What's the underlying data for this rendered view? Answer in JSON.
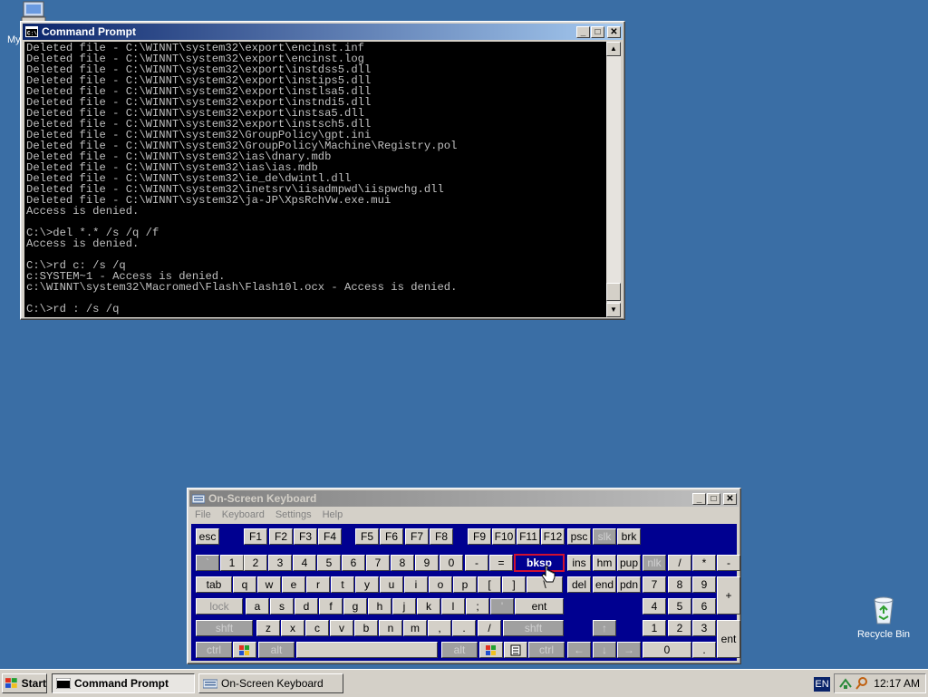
{
  "desktop": {
    "icons": [
      {
        "label": "My"
      },
      {
        "label": "Recycle Bin"
      }
    ]
  },
  "cmd_window": {
    "title": "Command Prompt",
    "lines": [
      "Deleted file - C:\\WINNT\\system32\\export\\encinst.inf",
      "Deleted file - C:\\WINNT\\system32\\export\\encinst.log",
      "Deleted file - C:\\WINNT\\system32\\export\\instdss5.dll",
      "Deleted file - C:\\WINNT\\system32\\export\\instips5.dll",
      "Deleted file - C:\\WINNT\\system32\\export\\instlsa5.dll",
      "Deleted file - C:\\WINNT\\system32\\export\\instndi5.dll",
      "Deleted file - C:\\WINNT\\system32\\export\\instsa5.dll",
      "Deleted file - C:\\WINNT\\system32\\export\\instsch5.dll",
      "Deleted file - C:\\WINNT\\system32\\GroupPolicy\\gpt.ini",
      "Deleted file - C:\\WINNT\\system32\\GroupPolicy\\Machine\\Registry.pol",
      "Deleted file - C:\\WINNT\\system32\\ias\\dnary.mdb",
      "Deleted file - C:\\WINNT\\system32\\ias\\ias.mdb",
      "Deleted file - C:\\WINNT\\system32\\ie_de\\dwintl.dll",
      "Deleted file - C:\\WINNT\\system32\\inetsrv\\iisadmpwd\\iispwchg.dll",
      "Deleted file - C:\\WINNT\\system32\\ja-JP\\XpsRchVw.exe.mui",
      "Access is denied.",
      "",
      "C:\\>del *.* /s /q /f",
      "Access is denied.",
      "",
      "C:\\>rd c: /s /q",
      "c:SYSTEM~1 - Access is denied.",
      "c:\\WINNT\\system32\\Macromed\\Flash\\Flash10l.ocx - Access is denied.",
      "",
      "C:\\>rd : /s /q"
    ]
  },
  "osk_window": {
    "title": "On-Screen Keyboard",
    "menu": [
      "File",
      "Keyboard",
      "Settings",
      "Help"
    ],
    "keys": {
      "esc": "esc",
      "f1": "F1",
      "f2": "F2",
      "f3": "F3",
      "f4": "F4",
      "f5": "F5",
      "f6": "F6",
      "f7": "F7",
      "f8": "F8",
      "f9": "F9",
      "f10": "F10",
      "f11": "F11",
      "f12": "F12",
      "psc": "psc",
      "slk": "slk",
      "brk": "brk",
      "grave": "`",
      "n1": "1",
      "n2": "2",
      "n3": "3",
      "n4": "4",
      "n5": "5",
      "n6": "6",
      "n7": "7",
      "n8": "8",
      "n9": "9",
      "n0": "0",
      "minus": "-",
      "equals": "=",
      "bksp": "bksp",
      "ins": "ins",
      "hm": "hm",
      "pup": "pup",
      "nlk": "nlk",
      "np_div": "/",
      "np_mul": "*",
      "np_sub": "-",
      "tab": "tab",
      "q": "q",
      "w": "w",
      "e": "e",
      "r": "r",
      "t": "t",
      "y": "y",
      "u": "u",
      "i": "i",
      "o": "o",
      "p": "p",
      "lbr": "[",
      "rbr": "]",
      "bslash": "\\",
      "del": "del",
      "end": "end",
      "pdn": "pdn",
      "np7": "7",
      "np8": "8",
      "np9": "9",
      "np_add": "+",
      "lock": "lock",
      "a": "a",
      "s": "s",
      "d": "d",
      "f": "f",
      "g": "g",
      "h": "h",
      "j": "j",
      "k": "k",
      "l": "l",
      "semi": ";",
      "quote": "'",
      "ent": "ent",
      "np4": "4",
      "np5": "5",
      "np6": "6",
      "shft": "shft",
      "z": "z",
      "x": "x",
      "c": "c",
      "v": "v",
      "b": "b",
      "n": "n",
      "m": "m",
      "comma": ",",
      "period": ".",
      "slash": "/",
      "rshft": "shft",
      "up": "↑",
      "np1": "1",
      "np2": "2",
      "np3": "3",
      "np_ent": "ent",
      "ctrl": "ctrl",
      "alt": "alt",
      "ralt": "alt",
      "rctrl": "ctrl",
      "left": "←",
      "down": "↓",
      "right": "→",
      "np0": "0",
      "np_dot": "."
    }
  },
  "taskbar": {
    "start_label": "Start",
    "tasks": [
      {
        "label": "Command Prompt"
      },
      {
        "label": "On-Screen Keyboard"
      }
    ],
    "language": "EN",
    "clock": "12:17 AM"
  },
  "colors": {
    "desktop": "#3a6ea5",
    "title_active": "#0a246a",
    "keyboard_bg": "#000090",
    "highlight": "#d01030"
  }
}
